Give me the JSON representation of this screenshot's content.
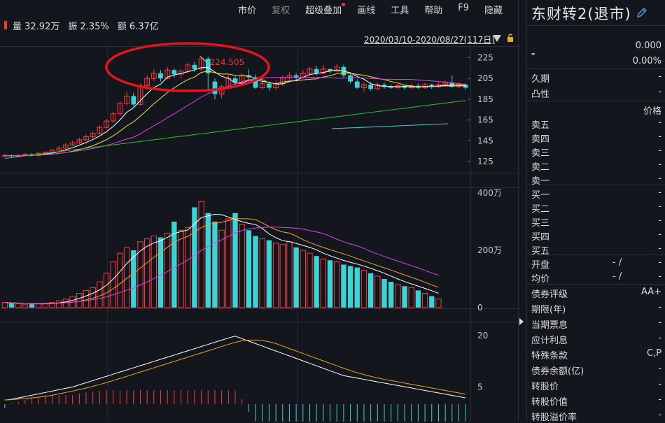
{
  "menu": [
    {
      "label": "市价",
      "dim": false
    },
    {
      "label": "复权",
      "dim": true
    },
    {
      "label": "超级叠加",
      "dim": false,
      "dot": true
    },
    {
      "label": "画线",
      "dim": false
    },
    {
      "label": "工具",
      "dim": false
    },
    {
      "label": "帮助",
      "dim": false
    },
    {
      "label": "F9",
      "dim": false
    },
    {
      "label": "隐藏",
      "dim": false
    }
  ],
  "stats": {
    "volume": "量 32.92万",
    "amplitude": "振 2.35%",
    "amount": "额 6.37亿"
  },
  "range_label": "2020/03/10-2020/08/27(117日)",
  "price_axis": [
    "225",
    "205",
    "185",
    "165",
    "145",
    "125"
  ],
  "volume_axis": [
    "400万",
    "200万",
    "0"
  ],
  "macd_axis": [
    "20",
    "5"
  ],
  "high_marker": "224.505",
  "colors": {
    "up": "#ff3b3b",
    "down": "#3ad3d6",
    "ma5": "#ffffff",
    "ma10": "#f0e040",
    "ma20": "#e040e0",
    "ma60": "#2ec02e",
    "ma120": "#3ad3d6",
    "highlight": "#e3141b"
  },
  "panel": {
    "name": "东财转2(退市)",
    "price": "0.000",
    "change": "-",
    "change_pct": "0.00%",
    "rows1": [
      {
        "label": "久期",
        "value": "-"
      },
      {
        "label": "凸性",
        "value": "-"
      }
    ],
    "price_header": "价格",
    "sell": [
      {
        "label": "卖五",
        "value": "-"
      },
      {
        "label": "卖四",
        "value": "-"
      },
      {
        "label": "卖三",
        "value": "-"
      },
      {
        "label": "卖二",
        "value": "-"
      },
      {
        "label": "卖一",
        "value": "-"
      }
    ],
    "buy": [
      {
        "label": "买一",
        "value": "-"
      },
      {
        "label": "买二",
        "value": "-"
      },
      {
        "label": "买三",
        "value": "-"
      },
      {
        "label": "买四",
        "value": "-"
      },
      {
        "label": "买五",
        "value": "-"
      }
    ],
    "open": {
      "label": "开盘",
      "value": "- /",
      "value2": "-"
    },
    "avg": {
      "label": "均价",
      "value": "- /",
      "value2": "-"
    },
    "info": [
      {
        "label": "债券评级",
        "value": "AA+"
      },
      {
        "label": "期限(年)",
        "value": "-"
      },
      {
        "label": "当期票息",
        "value": "-"
      },
      {
        "label": "应计利息",
        "value": "-"
      },
      {
        "label": "特殊条款",
        "value": "C,P"
      },
      {
        "label": "债券余额(亿)",
        "value": "-"
      },
      {
        "label": "转股价",
        "value": "-"
      },
      {
        "label": "转股价值",
        "value": "-"
      },
      {
        "label": "转股溢价率",
        "value": "-"
      }
    ]
  },
  "chart_data": {
    "type": "candlestick",
    "price_range": [
      115,
      232
    ],
    "volume_max_wan": 400,
    "candles": [
      {
        "o": 130,
        "c": 131,
        "h": 132,
        "l": 129
      },
      {
        "o": 131,
        "c": 130,
        "h": 132,
        "l": 129
      },
      {
        "o": 130,
        "c": 131,
        "h": 132,
        "l": 129
      },
      {
        "o": 131,
        "c": 132,
        "h": 133,
        "l": 130
      },
      {
        "o": 132,
        "c": 131,
        "h": 133,
        "l": 130
      },
      {
        "o": 131,
        "c": 133,
        "h": 134,
        "l": 130
      },
      {
        "o": 133,
        "c": 134,
        "h": 135,
        "l": 132
      },
      {
        "o": 134,
        "c": 136,
        "h": 137,
        "l": 133
      },
      {
        "o": 136,
        "c": 138,
        "h": 140,
        "l": 135
      },
      {
        "o": 138,
        "c": 141,
        "h": 143,
        "l": 137
      },
      {
        "o": 141,
        "c": 143,
        "h": 145,
        "l": 140
      },
      {
        "o": 143,
        "c": 146,
        "h": 148,
        "l": 142
      },
      {
        "o": 146,
        "c": 149,
        "h": 151,
        "l": 145
      },
      {
        "o": 149,
        "c": 152,
        "h": 154,
        "l": 147
      },
      {
        "o": 152,
        "c": 158,
        "h": 160,
        "l": 151
      },
      {
        "o": 158,
        "c": 164,
        "h": 166,
        "l": 156
      },
      {
        "o": 164,
        "c": 171,
        "h": 173,
        "l": 162
      },
      {
        "o": 171,
        "c": 181,
        "h": 183,
        "l": 169
      },
      {
        "o": 181,
        "c": 188,
        "h": 192,
        "l": 179
      },
      {
        "o": 188,
        "c": 180,
        "h": 191,
        "l": 178
      },
      {
        "o": 180,
        "c": 198,
        "h": 200,
        "l": 179
      },
      {
        "o": 198,
        "c": 205,
        "h": 208,
        "l": 196
      },
      {
        "o": 205,
        "c": 210,
        "h": 214,
        "l": 202
      },
      {
        "o": 210,
        "c": 205,
        "h": 213,
        "l": 202
      },
      {
        "o": 205,
        "c": 213,
        "h": 216,
        "l": 204
      },
      {
        "o": 213,
        "c": 209,
        "h": 215,
        "l": 206
      },
      {
        "o": 209,
        "c": 212,
        "h": 214,
        "l": 205
      },
      {
        "o": 212,
        "c": 218,
        "h": 220,
        "l": 210
      },
      {
        "o": 218,
        "c": 214,
        "h": 221,
        "l": 211
      },
      {
        "o": 214,
        "c": 224,
        "h": 224.5,
        "l": 212
      },
      {
        "o": 224,
        "c": 210,
        "h": 226,
        "l": 192
      },
      {
        "o": 202,
        "c": 190,
        "h": 205,
        "l": 185
      },
      {
        "o": 190,
        "c": 197,
        "h": 199,
        "l": 186
      },
      {
        "o": 197,
        "c": 205,
        "h": 208,
        "l": 195
      },
      {
        "o": 205,
        "c": 201,
        "h": 208,
        "l": 198
      },
      {
        "o": 201,
        "c": 208,
        "h": 210,
        "l": 199
      },
      {
        "o": 208,
        "c": 206,
        "h": 214,
        "l": 202
      },
      {
        "o": 206,
        "c": 196,
        "h": 209,
        "l": 195
      },
      {
        "o": 196,
        "c": 200,
        "h": 203,
        "l": 194
      },
      {
        "o": 200,
        "c": 196,
        "h": 202,
        "l": 193
      },
      {
        "o": 196,
        "c": 200,
        "h": 203,
        "l": 194
      },
      {
        "o": 200,
        "c": 206,
        "h": 208,
        "l": 198
      },
      {
        "o": 206,
        "c": 208,
        "h": 211,
        "l": 204
      },
      {
        "o": 208,
        "c": 206,
        "h": 210,
        "l": 203
      },
      {
        "o": 206,
        "c": 210,
        "h": 213,
        "l": 205
      },
      {
        "o": 210,
        "c": 214,
        "h": 216,
        "l": 208
      },
      {
        "o": 214,
        "c": 210,
        "h": 217,
        "l": 208
      },
      {
        "o": 210,
        "c": 214,
        "h": 218,
        "l": 209
      },
      {
        "o": 214,
        "c": 212,
        "h": 215,
        "l": 210
      },
      {
        "o": 212,
        "c": 216,
        "h": 219,
        "l": 211
      },
      {
        "o": 216,
        "c": 208,
        "h": 218,
        "l": 206
      },
      {
        "o": 208,
        "c": 202,
        "h": 210,
        "l": 200
      },
      {
        "o": 202,
        "c": 196,
        "h": 204,
        "l": 195
      },
      {
        "o": 196,
        "c": 199,
        "h": 201,
        "l": 192
      },
      {
        "o": 199,
        "c": 195,
        "h": 201,
        "l": 193
      },
      {
        "o": 195,
        "c": 199,
        "h": 201,
        "l": 194
      },
      {
        "o": 199,
        "c": 197,
        "h": 201,
        "l": 195
      },
      {
        "o": 197,
        "c": 196,
        "h": 199,
        "l": 195
      },
      {
        "o": 196,
        "c": 198,
        "h": 200,
        "l": 195
      },
      {
        "o": 198,
        "c": 196,
        "h": 199,
        "l": 194
      },
      {
        "o": 196,
        "c": 198,
        "h": 200,
        "l": 195
      },
      {
        "o": 198,
        "c": 196,
        "h": 200,
        "l": 195
      },
      {
        "o": 196,
        "c": 199,
        "h": 201,
        "l": 195
      },
      {
        "o": 199,
        "c": 197,
        "h": 200,
        "l": 195
      },
      {
        "o": 197,
        "c": 199,
        "h": 201,
        "l": 196
      },
      {
        "o": 199,
        "c": 201,
        "h": 203,
        "l": 198
      },
      {
        "o": 201,
        "c": 197,
        "h": 208,
        "l": 196
      },
      {
        "o": 197,
        "c": 199,
        "h": 201,
        "l": 196
      },
      {
        "o": 199,
        "c": 196,
        "h": 200,
        "l": 194
      }
    ],
    "volumes": [
      18,
      16,
      14,
      10,
      12,
      14,
      15,
      18,
      24,
      30,
      40,
      50,
      60,
      70,
      90,
      120,
      160,
      190,
      210,
      200,
      230,
      240,
      250,
      245,
      260,
      300,
      270,
      280,
      350,
      370,
      330,
      300,
      270,
      310,
      330,
      290,
      270,
      250,
      240,
      235,
      225,
      220,
      230,
      210,
      200,
      190,
      180,
      170,
      165,
      160,
      150,
      145,
      140,
      130,
      120,
      110,
      100,
      90,
      80,
      75,
      70,
      60,
      50,
      40,
      30
    ]
  }
}
